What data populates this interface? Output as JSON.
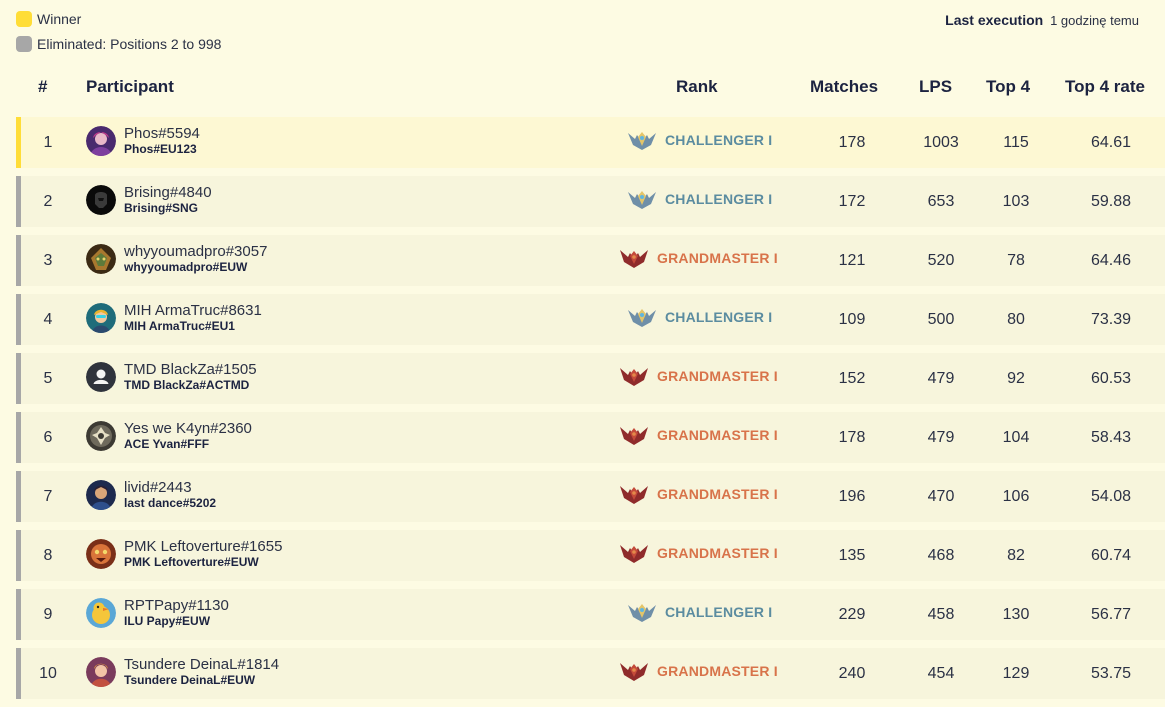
{
  "legend": {
    "winner_label": "Winner",
    "winner_color": "#ffdd37",
    "eliminated_label": "Eliminated: Positions 2 to 998",
    "eliminated_color": "#a7a7a7"
  },
  "last_execution": {
    "label": "Last execution",
    "value": "1 godzinę temu"
  },
  "table": {
    "headers": {
      "num": "#",
      "participant": "Participant",
      "rank": "Rank",
      "matches": "Matches",
      "lps": "LPS",
      "top4": "Top 4",
      "top4_rate": "Top 4 rate"
    },
    "rows": [
      {
        "num": "1",
        "name": "Phos#5594",
        "account": "Phos#EU123",
        "rank": "CHALLENGER I",
        "tier": "challenger",
        "matches": "178",
        "lps": "1003",
        "top4": "115",
        "rate": "64.61",
        "avatar": "purple-champion-avatar"
      },
      {
        "num": "2",
        "name": "Brising#4840",
        "account": "Brising#SNG",
        "rank": "CHALLENGER I",
        "tier": "challenger",
        "matches": "172",
        "lps": "653",
        "top4": "103",
        "rate": "59.88",
        "avatar": "dark-helmet-avatar"
      },
      {
        "num": "3",
        "name": "whyyoumadpro#3057",
        "account": "whyyoumadpro#EUW",
        "rank": "GRANDMASTER I",
        "tier": "grandmaster",
        "matches": "121",
        "lps": "520",
        "top4": "78",
        "rate": "64.46",
        "avatar": "golden-mask-avatar"
      },
      {
        "num": "4",
        "name": "MIH ArmaTruc#8631",
        "account": "MIH ArmaTruc#EU1",
        "rank": "CHALLENGER I",
        "tier": "challenger",
        "matches": "109",
        "lps": "500",
        "top4": "80",
        "rate": "73.39",
        "avatar": "teal-champion-avatar"
      },
      {
        "num": "5",
        "name": "TMD BlackZa#1505",
        "account": "TMD BlackZa#ACTMD",
        "rank": "GRANDMASTER I",
        "tier": "grandmaster",
        "matches": "152",
        "lps": "479",
        "top4": "92",
        "rate": "60.53",
        "avatar": "default-user-avatar"
      },
      {
        "num": "6",
        "name": "Yes we K4yn#2360",
        "account": "ACE Yvan#FFF",
        "rank": "GRANDMASTER I",
        "tier": "grandmaster",
        "matches": "178",
        "lps": "479",
        "top4": "104",
        "rate": "58.43",
        "avatar": "emblem-avatar"
      },
      {
        "num": "7",
        "name": "livid#2443",
        "account": "last dance#5202",
        "rank": "GRANDMASTER I",
        "tier": "grandmaster",
        "matches": "196",
        "lps": "470",
        "top4": "106",
        "rate": "54.08",
        "avatar": "blue-champion-avatar"
      },
      {
        "num": "8",
        "name": "PMK Leftoverture#1655",
        "account": "PMK Leftoverture#EUW",
        "rank": "GRANDMASTER I",
        "tier": "grandmaster",
        "matches": "135",
        "lps": "468",
        "top4": "82",
        "rate": "60.74",
        "avatar": "orange-creature-avatar"
      },
      {
        "num": "9",
        "name": "RPTPapy#1130",
        "account": "ILU Papy#EUW",
        "rank": "CHALLENGER I",
        "tier": "challenger",
        "matches": "229",
        "lps": "458",
        "top4": "130",
        "rate": "56.77",
        "avatar": "duck-avatar"
      },
      {
        "num": "10",
        "name": "Tsundere DeinaL#1814",
        "account": "Tsundere DeinaL#EUW",
        "rank": "GRANDMASTER I",
        "tier": "grandmaster",
        "matches": "240",
        "lps": "454",
        "top4": "129",
        "rate": "53.75",
        "avatar": "pink-champion-avatar"
      }
    ]
  },
  "colors": {
    "background": "#fdfbe3",
    "challenger": "#5b8ca0",
    "grandmaster": "#d8734a"
  }
}
